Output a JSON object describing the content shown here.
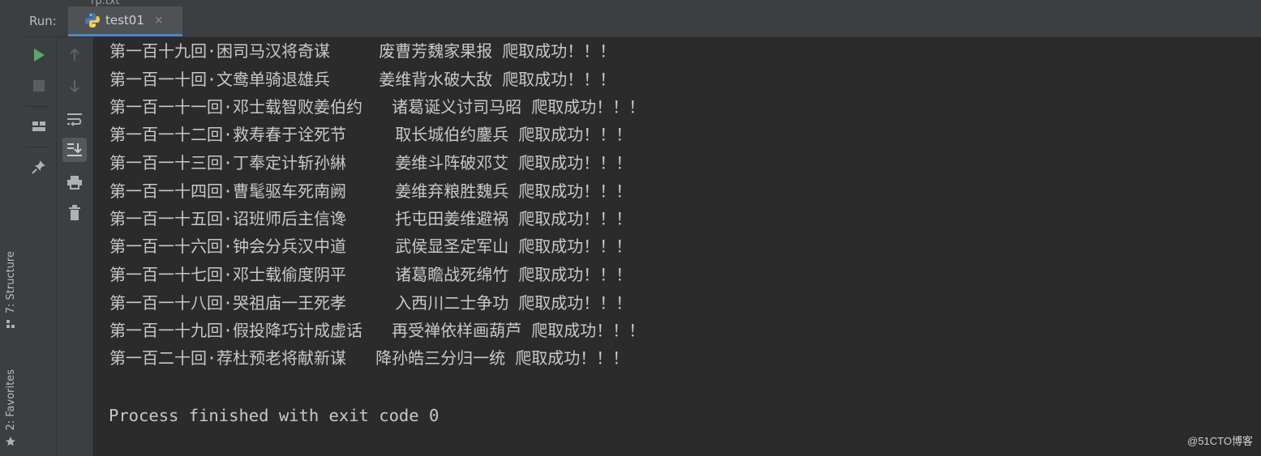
{
  "top_sliver": {
    "prev_tab_label": "rp.txt"
  },
  "outer_stripe": {
    "structure_tab": "7: Structure",
    "favorites_tab": "2: Favorites"
  },
  "run_panel": {
    "label": "Run:",
    "tab_title": "test01",
    "tab_close": "×"
  },
  "toolbar": {
    "left_column": [
      "run-icon",
      "stop-icon",
      "layout-icon",
      "pin-icon"
    ],
    "right_column": [
      "up-arrow-icon",
      "down-arrow-icon",
      "soft-wrap-icon",
      "scroll-to-end-icon",
      "print-icon",
      "trash-icon"
    ]
  },
  "console": {
    "lines": [
      "第一百十九回·困司马汉将奇谋     废曹芳魏家果报 爬取成功！！！",
      "第一百一十回·文鸯单骑退雄兵     姜维背水破大敌 爬取成功！！！",
      "第一百一十一回·邓士载智败姜伯约   诸葛诞义讨司马昭 爬取成功！！！",
      "第一百一十二回·救寿春于诠死节     取长城伯约鏖兵 爬取成功！！！",
      "第一百一十三回·丁奉定计斩孙綝     姜维斗阵破邓艾 爬取成功！！！",
      "第一百一十四回·曹髦驱车死南阙     姜维弃粮胜魏兵 爬取成功！！！",
      "第一百一十五回·诏班师后主信谗     托屯田姜维避祸 爬取成功！！！",
      "第一百一十六回·钟会分兵汉中道     武侯显圣定军山 爬取成功！！！",
      "第一百一十七回·邓士载偷度阴平     诸葛瞻战死绵竹 爬取成功！！！",
      "第一百一十八回·哭祖庙一王死孝     入西川二士争功 爬取成功！！！",
      "第一百一十九回·假投降巧计成虚话   再受禅依样画葫芦 爬取成功！！！",
      "第一百二十回·荐杜预老将献新谋   降孙皓三分归一统 爬取成功！！！"
    ],
    "process_message": "Process finished with exit code 0"
  },
  "watermark": "@51CTO博客",
  "colors": {
    "background": "#2b2b2b",
    "panel": "#3c3f41",
    "text": "#c8c8c8",
    "tab_underline": "#4a88c7"
  }
}
